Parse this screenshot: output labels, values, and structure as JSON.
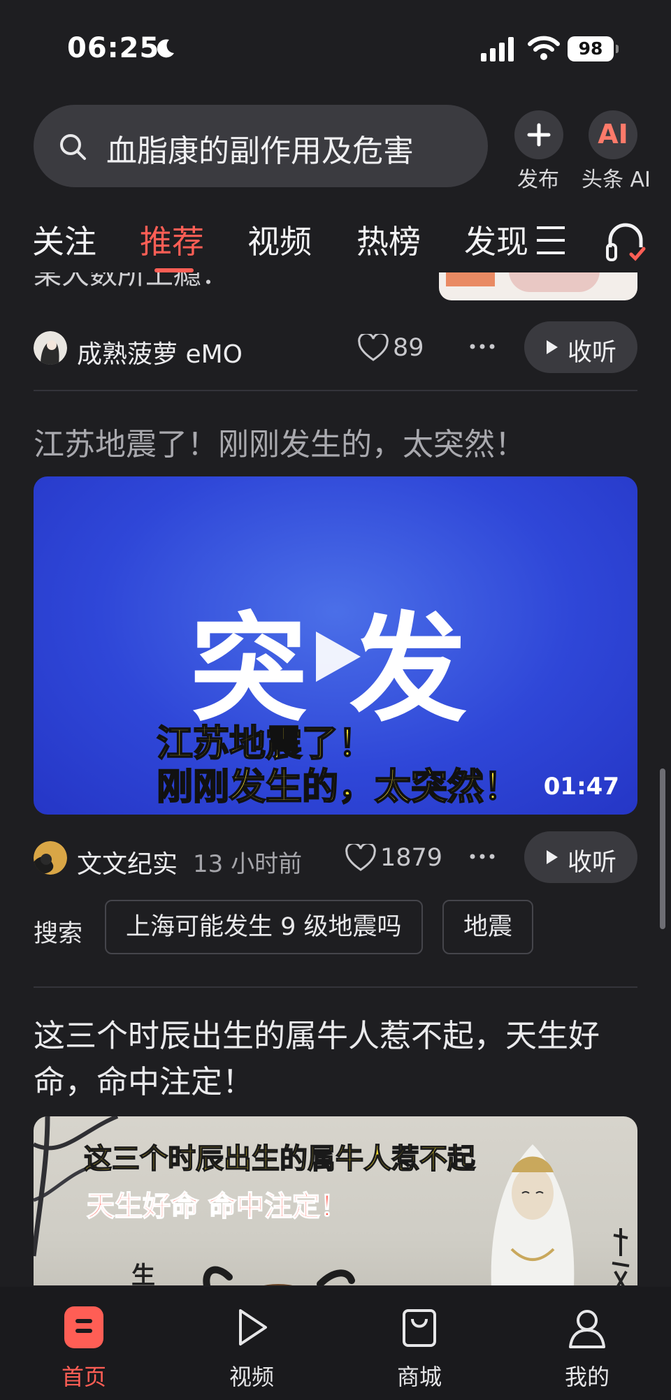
{
  "status_bar": {
    "time": "06:25",
    "battery": "98"
  },
  "header": {
    "search_query": "血脂康的副作用及危害",
    "publish_label": "发布",
    "ai_glyph": "AI",
    "ai_label": "头条 AI"
  },
  "tabs": [
    "关注",
    "推荐",
    "视频",
    "热榜",
    "发现"
  ],
  "feed": {
    "partial_item": {
      "title_fragment": "某大数所上瘾：",
      "author": "成熟菠萝 eMO",
      "likes": "89",
      "listen_label": "收听"
    },
    "video_item": {
      "title": "江苏地震了！刚刚发生的，太突然！",
      "thumb_big_text": "突发",
      "thumb_overlay_1": "江苏地震了！",
      "thumb_overlay_2": "刚刚发生的，太突然！",
      "duration": "01:47",
      "author": "文文纪实",
      "time_ago": "13 小时前",
      "likes": "1879",
      "listen_label": "收听"
    },
    "related_search": {
      "label": "搜索",
      "chips": [
        "上海可能发生 9 级地震吗",
        "地震"
      ]
    },
    "article_item": {
      "title": "这三个时辰出生的属牛人惹不起，天生好命，命中注定！",
      "image_line_1": "这三个时辰出生的属牛人惹不起",
      "image_line_2": "天生好命 命中注定！",
      "image_side_char": "生"
    }
  },
  "bottom_nav": [
    {
      "label": "首页",
      "icon": "home-icon",
      "active": true
    },
    {
      "label": "视频",
      "icon": "play-icon",
      "active": false
    },
    {
      "label": "商城",
      "icon": "shop-bag-icon",
      "active": false
    },
    {
      "label": "我的",
      "icon": "profile-icon",
      "active": false
    }
  ],
  "colors": {
    "accent": "#ff5e55",
    "background": "#1e1e21",
    "video_blue": "#2f47d8"
  }
}
